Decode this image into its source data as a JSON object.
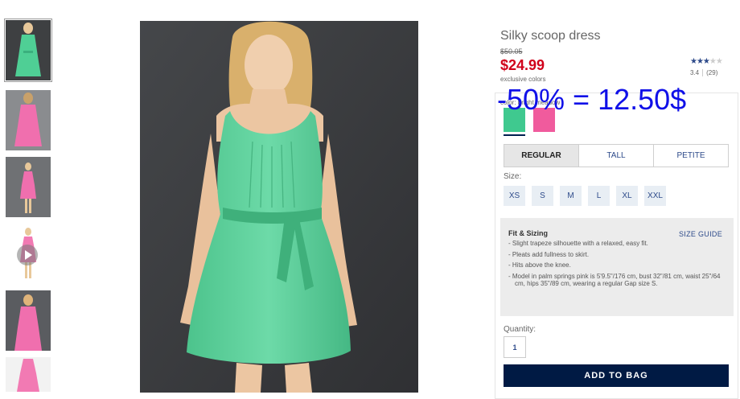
{
  "thumbnails": [
    {
      "label": "model-front-green",
      "active": true
    },
    {
      "label": "model-back-pink"
    },
    {
      "label": "model-full-pink"
    },
    {
      "label": "video-pink",
      "has_play": true
    },
    {
      "label": "model-front-pink"
    },
    {
      "label": "dress-flat-pink"
    }
  ],
  "product": {
    "title": "Silky scoop dress",
    "old_price": "$50.05",
    "price": "$24.99",
    "price_note": "exclusive colors",
    "rating_value": "3.4",
    "rating_count": "(29)",
    "rating_stars": 3.4,
    "color_label": "color: bright meadow",
    "swatches": [
      {
        "name": "bright meadow",
        "color": "#3fc98f",
        "selected": true
      },
      {
        "name": "pink",
        "color": "#f05b9d"
      }
    ],
    "fit_tabs": [
      {
        "label": "REGULAR",
        "active": true
      },
      {
        "label": "TALL"
      },
      {
        "label": "PETITE"
      }
    ],
    "size_label": "Size:",
    "sizes": [
      "XS",
      "S",
      "M",
      "L",
      "XL",
      "XXL"
    ],
    "fit": {
      "title": "Fit & Sizing",
      "size_guide": "SIZE GUIDE",
      "bullets": [
        "Slight trapeze silhouette with a relaxed, easy fit.",
        "Pleats add fullness to skirt.",
        "Hits above the knee.",
        "Model in palm springs pink is 5'9.5\"/176 cm, bust 32\"/81 cm, waist 25\"/64 cm, hips 35\"/89 cm, wearing a regular Gap size S."
      ]
    },
    "quantity_label": "Quantity:",
    "quantity": "1",
    "add_button": "ADD TO BAG"
  },
  "overlay_note": "-50% = 12.50$",
  "colors": {
    "accent": "#001a44",
    "sale": "#d0021b",
    "link": "#2d4a8a",
    "overlay": "#1010e8",
    "dress_green": "#5fd39f",
    "dress_pink": "#f27ab3",
    "photo_bg": "#3a3b3e"
  }
}
